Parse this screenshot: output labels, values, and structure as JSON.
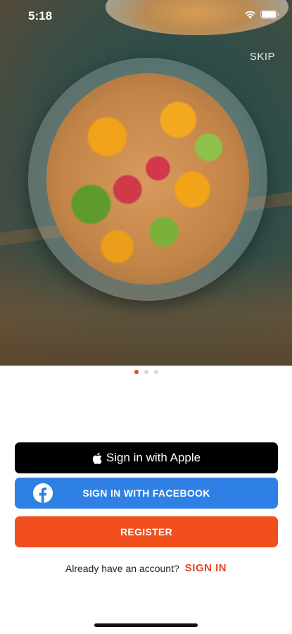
{
  "status_bar": {
    "time": "5:18"
  },
  "onboarding": {
    "skip_label": "SKIP",
    "page_count": 3,
    "active_page": 1
  },
  "auth": {
    "apple_label": "Sign in with Apple",
    "facebook_label": "SIGN IN WITH FACEBOOK",
    "register_label": "REGISTER",
    "have_account_text": "Already have an account?",
    "sign_in_label": "SIGN IN"
  },
  "colors": {
    "accent": "#f04f1d",
    "facebook": "#2f80e4",
    "apple": "#000000",
    "link": "#e8442a"
  },
  "icons": [
    "wifi-icon",
    "battery-icon",
    "apple-icon",
    "facebook-icon"
  ]
}
